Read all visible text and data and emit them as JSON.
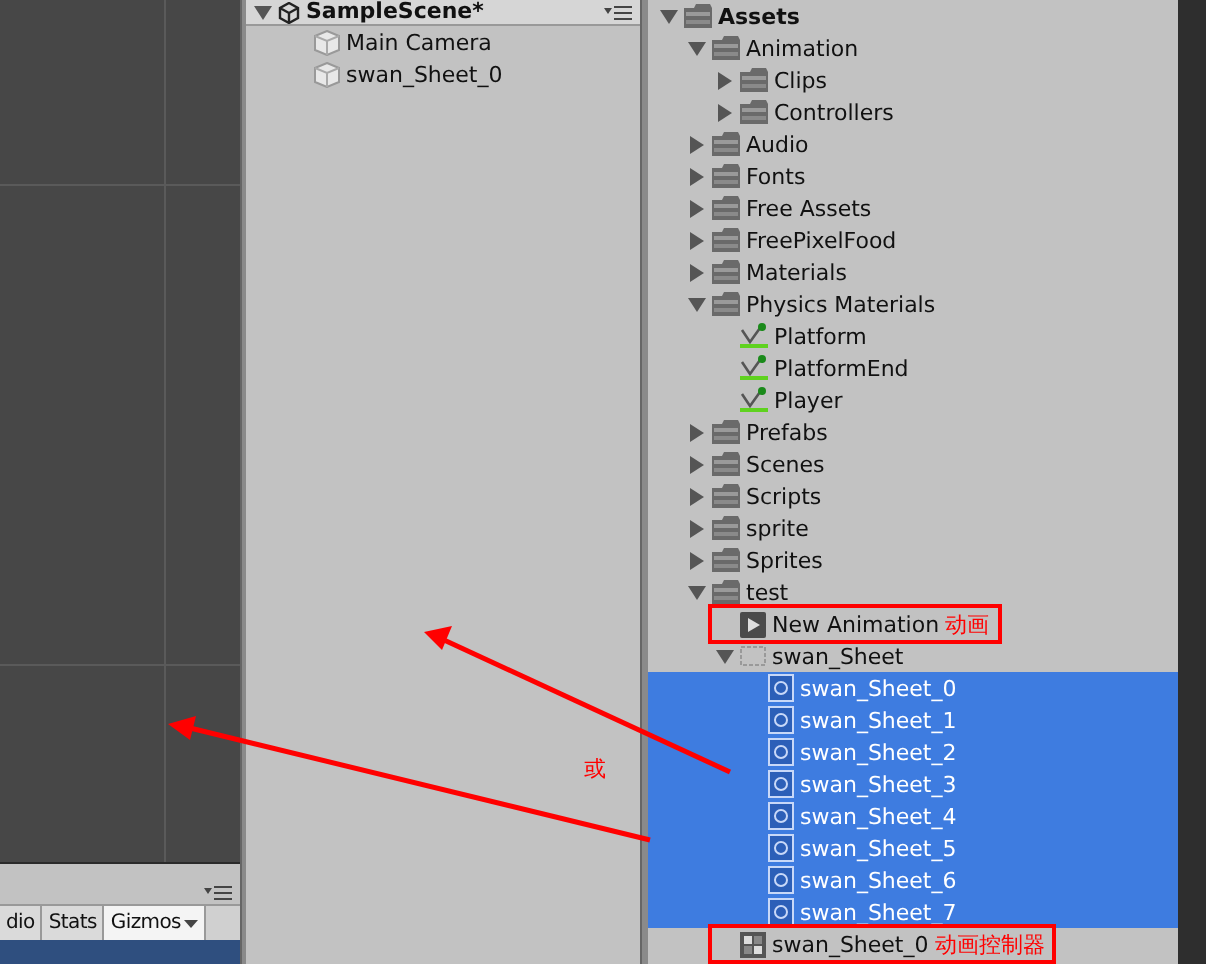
{
  "scene_view": {
    "toolbar": {
      "items": [
        {
          "label": "dio",
          "dropdown": false
        },
        {
          "label": "Stats",
          "dropdown": false
        },
        {
          "label": "Gizmos",
          "dropdown": true
        }
      ]
    }
  },
  "hierarchy": {
    "scene": {
      "name": "SampleScene*",
      "expanded": true
    },
    "items": [
      {
        "label": "Main Camera",
        "selected": false
      },
      {
        "label": "swan_Sheet_0",
        "selected": false
      }
    ]
  },
  "project": {
    "tree": [
      {
        "kind": "folder",
        "label": "Assets",
        "expanded": true,
        "selected": false,
        "children": [
          {
            "kind": "folder",
            "label": "Animation",
            "expanded": true,
            "selected": false,
            "children": [
              {
                "kind": "folder",
                "label": "Clips",
                "expanded": false,
                "selected": false
              },
              {
                "kind": "folder",
                "label": "Controllers",
                "expanded": false,
                "selected": false
              }
            ]
          },
          {
            "kind": "folder",
            "label": "Audio",
            "expanded": false,
            "selected": false
          },
          {
            "kind": "folder",
            "label": "Fonts",
            "expanded": false,
            "selected": false
          },
          {
            "kind": "folder",
            "label": "Free Assets",
            "expanded": false,
            "selected": false
          },
          {
            "kind": "folder",
            "label": "FreePixelFood",
            "expanded": false,
            "selected": false
          },
          {
            "kind": "folder",
            "label": "Materials",
            "expanded": false,
            "selected": false
          },
          {
            "kind": "folder",
            "label": "Physics Materials",
            "expanded": true,
            "selected": false,
            "children": [
              {
                "kind": "physics-material",
                "label": "Platform",
                "selected": false
              },
              {
                "kind": "physics-material",
                "label": "PlatformEnd",
                "selected": false
              },
              {
                "kind": "physics-material",
                "label": "Player",
                "selected": false
              }
            ]
          },
          {
            "kind": "folder",
            "label": "Prefabs",
            "expanded": false,
            "selected": false
          },
          {
            "kind": "folder",
            "label": "Scenes",
            "expanded": false,
            "selected": false
          },
          {
            "kind": "folder",
            "label": "Scripts",
            "expanded": false,
            "selected": false
          },
          {
            "kind": "folder",
            "label": "sprite",
            "expanded": false,
            "selected": false
          },
          {
            "kind": "folder",
            "label": "Sprites",
            "expanded": false,
            "selected": false
          },
          {
            "kind": "folder",
            "label": "test",
            "expanded": true,
            "selected": false,
            "children": [
              {
                "kind": "animation",
                "label": "New Animation",
                "selected": false,
                "note": "动画"
              },
              {
                "kind": "sprite-sheet",
                "label": "swan_Sheet",
                "expanded": true,
                "selected": false,
                "children": [
                  {
                    "kind": "sprite",
                    "label": "swan_Sheet_0",
                    "selected": true
                  },
                  {
                    "kind": "sprite",
                    "label": "swan_Sheet_1",
                    "selected": true
                  },
                  {
                    "kind": "sprite",
                    "label": "swan_Sheet_2",
                    "selected": true
                  },
                  {
                    "kind": "sprite",
                    "label": "swan_Sheet_3",
                    "selected": true
                  },
                  {
                    "kind": "sprite",
                    "label": "swan_Sheet_4",
                    "selected": true
                  },
                  {
                    "kind": "sprite",
                    "label": "swan_Sheet_5",
                    "selected": true
                  },
                  {
                    "kind": "sprite",
                    "label": "swan_Sheet_6",
                    "selected": true
                  },
                  {
                    "kind": "sprite",
                    "label": "swan_Sheet_7",
                    "selected": true
                  }
                ]
              },
              {
                "kind": "controller",
                "label": "swan_Sheet_0",
                "selected": false,
                "note": "动画控制器"
              }
            ]
          }
        ]
      }
    ]
  },
  "annotation": {
    "label": "或"
  }
}
